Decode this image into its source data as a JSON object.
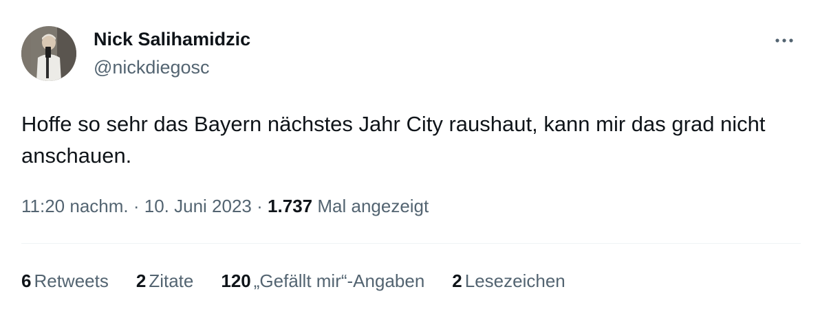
{
  "author": {
    "name": "Nick Salihamidzic",
    "handle": "@nickdiegosc",
    "avatar_icon": "profile-photo"
  },
  "menu": {
    "icon": "more-horizontal-icon"
  },
  "tweet": {
    "text": "Hoffe so sehr das Bayern nächstes Jahr City raushaut, kann mir das grad nicht anschauen."
  },
  "meta": {
    "time": "11:20 nachm.",
    "separator": "·",
    "date": "10. Juni 2023",
    "views_count": "1.737",
    "views_label": "Mal angezeigt"
  },
  "stats": {
    "retweets": {
      "count": "6",
      "label": "Retweets"
    },
    "quotes": {
      "count": "2",
      "label": "Zitate"
    },
    "likes": {
      "count": "120",
      "label": "„Gefällt mir“-Angaben"
    },
    "bookmarks": {
      "count": "2",
      "label": "Lesezeichen"
    }
  },
  "colors": {
    "text_primary": "#0f1419",
    "text_secondary": "#536471",
    "divider": "#eff3f4",
    "background": "#ffffff"
  }
}
